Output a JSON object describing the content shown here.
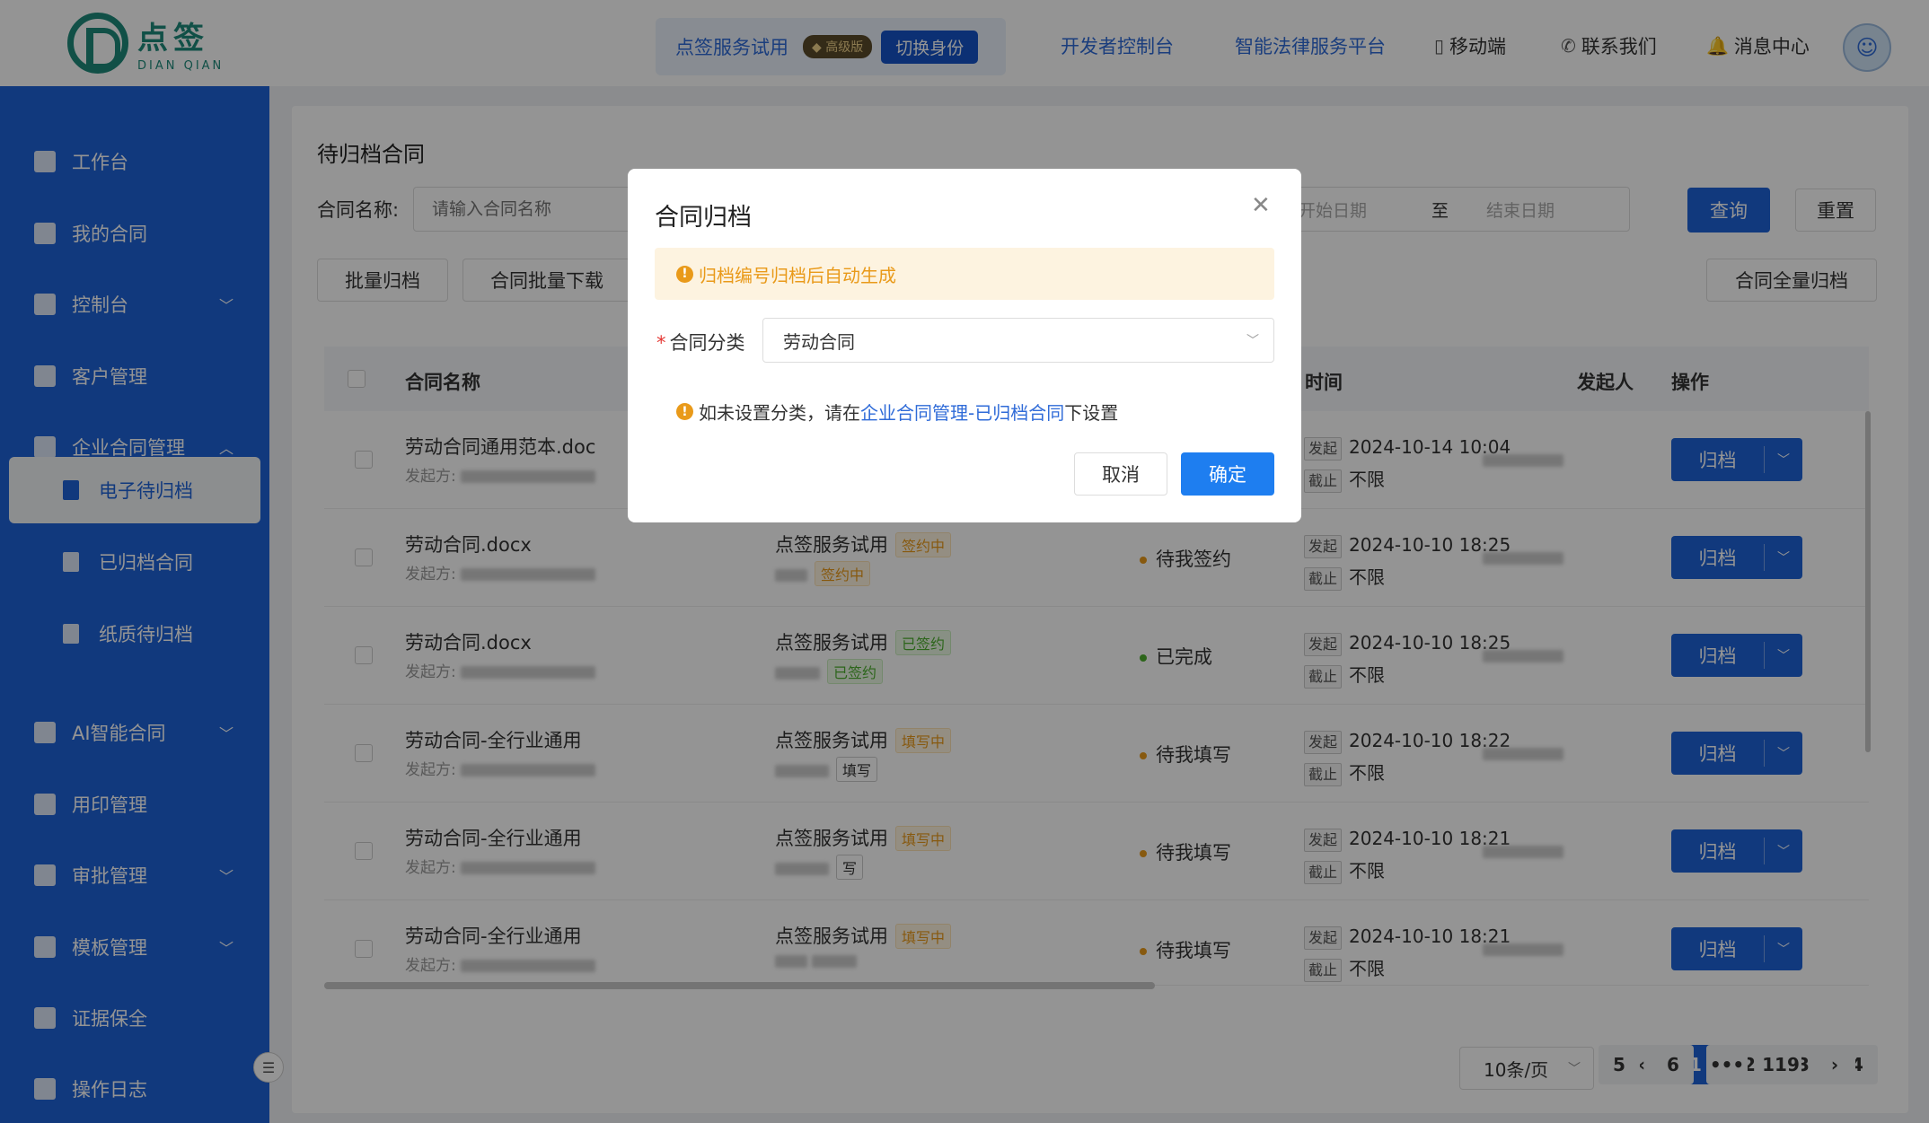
{
  "header": {
    "logo_cn": "点签",
    "logo_en": "DIAN QIAN",
    "trial_name": "点签服务试用",
    "vip_badge": "高级版",
    "switch_label": "切换身份",
    "dev_console": "开发者控制台",
    "legal_platform": "智能法律服务平台",
    "mobile": "移动端",
    "contact": "联系我们",
    "messages": "消息中心"
  },
  "sidebar": {
    "items": [
      {
        "label": "工作台"
      },
      {
        "label": "我的合同"
      },
      {
        "label": "控制台"
      },
      {
        "label": "客户管理"
      },
      {
        "label": "企业合同管理"
      },
      {
        "label": "电子待归档"
      },
      {
        "label": "已归档合同"
      },
      {
        "label": "纸质待归档"
      },
      {
        "label": "AI智能合同"
      },
      {
        "label": "用印管理"
      },
      {
        "label": "审批管理"
      },
      {
        "label": "模板管理"
      },
      {
        "label": "证据保全"
      },
      {
        "label": "操作日志"
      }
    ]
  },
  "main": {
    "title": "待归档合同",
    "filter_label": "合同名称:",
    "filter_placeholder": "请输入合同名称",
    "date_from": "开始日期",
    "date_to": "至",
    "date_end": "结束日期",
    "query": "查询",
    "reset": "重置",
    "batch_archive": "批量归档",
    "batch_download": "合同批量下载",
    "archive_all": "合同全量归档",
    "columns": {
      "name": "合同名称",
      "time": "时间",
      "initiator": "发起人",
      "op": "操作"
    },
    "sender_label": "发起方:",
    "start_tag": "发起",
    "deadline_tag": "截止",
    "op_label": "归档",
    "rows": [
      {
        "name": "劳动合同通用范本.doc",
        "party": "",
        "party_tag": "",
        "party2_tag": "",
        "status": "",
        "start": "2024-10-14 10:04",
        "deadline": "不限"
      },
      {
        "name": "劳动合同.docx",
        "party": "点签服务试用",
        "party_tag": "签约中",
        "party2_tag": "签约中",
        "status": "待我签约",
        "start": "2024-10-10 18:25",
        "deadline": "不限"
      },
      {
        "name": "劳动合同.docx",
        "party": "点签服务试用",
        "party_tag": "已签约",
        "party2_tag": "已签约",
        "status": "已完成",
        "start": "2024-10-10 18:25",
        "deadline": "不限"
      },
      {
        "name": "劳动合同-全行业通用",
        "party": "点签服务试用",
        "party_tag": "填写中",
        "party2_tag": "填写",
        "status": "待我填写",
        "start": "2024-10-10 18:22",
        "deadline": "不限"
      },
      {
        "name": "劳动合同-全行业通用",
        "party": "点签服务试用",
        "party_tag": "填写中",
        "party2_tag": "写",
        "status": "待我填写",
        "start": "2024-10-10 18:21",
        "deadline": "不限"
      },
      {
        "name": "劳动合同-全行业通用",
        "party": "点签服务试用",
        "party_tag": "填写中",
        "party2_tag": "",
        "status": "待我填写",
        "start": "2024-10-10 18:21",
        "deadline": "不限"
      }
    ]
  },
  "pagination": {
    "page_size": "10条/页",
    "pages": [
      "1",
      "2",
      "3",
      "4",
      "5",
      "6",
      "•••",
      "119"
    ],
    "prev": "‹",
    "next": "›"
  },
  "modal": {
    "title": "合同归档",
    "alert": "归档编号归档后自动生成",
    "category_label": "合同分类",
    "category_value": "劳动合同",
    "tip_prefix": "如未设置分类，请在",
    "tip_link": "企业合同管理-已归档合同",
    "tip_suffix": "下设置",
    "cancel": "取消",
    "ok": "确定"
  }
}
